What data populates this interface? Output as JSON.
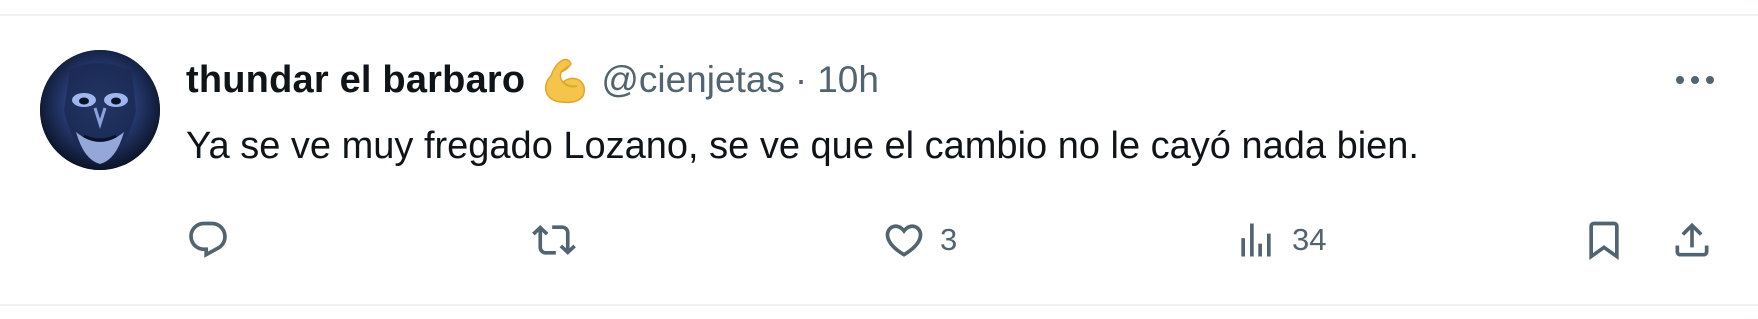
{
  "tweet": {
    "author": {
      "display_name": "thundar el barbaro",
      "badge_icon": "flexed-biceps-emoji",
      "handle": "@cienjetas"
    },
    "separator": "·",
    "time_ago": "10h",
    "text": "Ya se ve muy fregado Lozano, se ve que el cambio no le cayó nada bien.",
    "actions": {
      "reply": {
        "icon": "reply-icon",
        "count": ""
      },
      "retweet": {
        "icon": "retweet-icon",
        "count": ""
      },
      "like": {
        "icon": "heart-icon",
        "count": "3"
      },
      "views": {
        "icon": "views-icon",
        "count": "34"
      },
      "bookmark": {
        "icon": "bookmark-icon"
      },
      "share": {
        "icon": "share-icon"
      }
    }
  },
  "colors": {
    "text_primary": "#0f1419",
    "text_secondary": "#536471",
    "divider": "#eff3f4"
  }
}
